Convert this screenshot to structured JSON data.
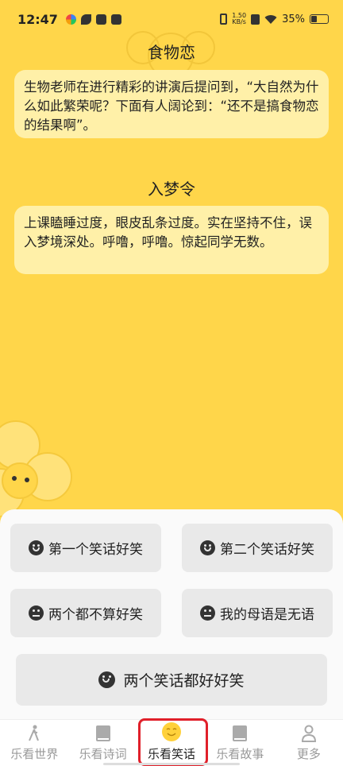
{
  "status_bar": {
    "time": "12:47",
    "netspeed_value": "1.50",
    "netspeed_unit": "KB/s",
    "battery": "35%",
    "battery_level": 0.35
  },
  "jokes": [
    {
      "title": "食物恋",
      "text": "生物老师在进行精彩的讲演后提问到，“大自然为什么如此繁荣呢？下面有人阔论到：“还不是搞食物恋的结果啊”。"
    },
    {
      "title": "入梦令",
      "text": "上课瞌睡过度，眼皮乱条过度。实在坚持不住，误入梦境深处。呼噜，呼噜。惊起同学无数。"
    }
  ],
  "vote": {
    "first": "第一个笑话好笑",
    "second": "第二个笑话好笑",
    "neither": "两个都不算好笑",
    "speechless": "我的母语是无语",
    "both": "两个笑话都好好笑"
  },
  "tabs": [
    {
      "label": "乐看世界",
      "icon": "walker-icon"
    },
    {
      "label": "乐看诗词",
      "icon": "book-icon"
    },
    {
      "label": "乐看笑话",
      "icon": "smile-icon"
    },
    {
      "label": "乐看故事",
      "icon": "book-icon"
    },
    {
      "label": "更多",
      "icon": "person-icon"
    }
  ],
  "colors": {
    "background": "#ffd64a",
    "card": "#fff0a8",
    "highlight": "#e0202a"
  }
}
